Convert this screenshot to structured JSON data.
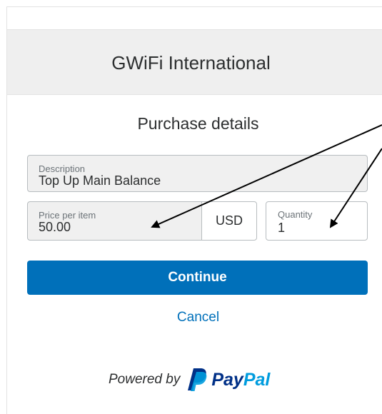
{
  "merchant": {
    "name": "GWiFi International"
  },
  "purchase": {
    "title": "Purchase details",
    "description": {
      "label": "Description",
      "value": "Top Up Main Balance"
    },
    "price": {
      "label": "Price per item",
      "value": "50.00",
      "currency": "USD"
    },
    "quantity": {
      "label": "Quantity",
      "value": "1"
    }
  },
  "actions": {
    "continue_label": "Continue",
    "cancel_label": "Cancel"
  },
  "footer": {
    "powered_by": "Powered by",
    "brand_part1": "Pay",
    "brand_part2": "Pal"
  },
  "colors": {
    "primary": "#0070ba",
    "brand_dark": "#003087",
    "brand_light": "#009cde",
    "header_bg": "#efefef"
  }
}
